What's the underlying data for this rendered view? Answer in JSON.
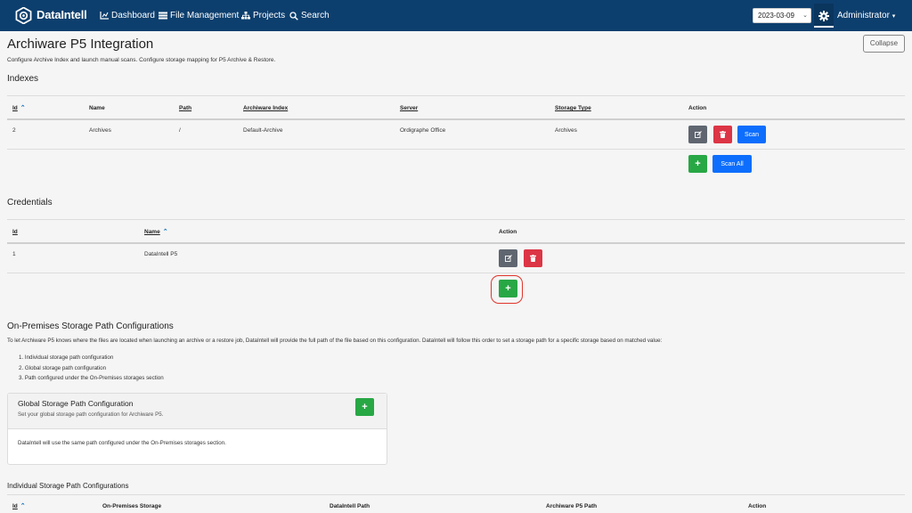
{
  "nav": {
    "brand": "DataIntell",
    "links": [
      {
        "label": "Dashboard",
        "icon": "chart-line-icon"
      },
      {
        "label": "File Management",
        "icon": "list-icon"
      },
      {
        "label": "Projects",
        "icon": "sitemap-icon"
      },
      {
        "label": "Search",
        "icon": "search-icon"
      }
    ],
    "date": "2023-03-09",
    "user": "Administrator"
  },
  "page": {
    "title": "Archiware P5 Integration",
    "subtitle": "Configure Archive Index and launch manual scans. Configure storage mapping for P5 Archive & Restore.",
    "collapse_label": "Collapse"
  },
  "indexes": {
    "heading": "Indexes",
    "columns": [
      "Id",
      "Name",
      "Path",
      "Archiware Index",
      "Server",
      "Storage Type",
      "Action"
    ],
    "rows": [
      {
        "id": "2",
        "name": "Archives",
        "path": "/",
        "index": "Default-Archive",
        "server": "Ordigraphe Office",
        "storage_type": "Archives"
      }
    ],
    "scan_label": "Scan",
    "scan_all_label": "Scan All",
    "add_symbol": "+"
  },
  "credentials": {
    "heading": "Credentials",
    "columns": [
      "Id",
      "Name",
      "Action"
    ],
    "rows": [
      {
        "id": "1",
        "name": "DataIntell P5"
      }
    ],
    "add_symbol": "+"
  },
  "onprem": {
    "heading": "On-Premises Storage Path Configurations",
    "description": "To let Archiware P5 knows where the files are located when launching an archive or a restore job, DataIntell will provide the full path of the file based on this configuration. DataIntell will follow this order to set a storage path for a specific storage based on matched value:",
    "order": [
      "1. Individual storage path configuration",
      "2. Global storage path configuration",
      "3. Path configured under the On-Premises storages section"
    ],
    "global_card": {
      "title": "Global Storage Path Configuration",
      "subtitle": "Set your global storage path configuration for Archiware P5.",
      "body": "DataIntell will use the same path configured under the On-Premises storages section.",
      "add_symbol": "+"
    },
    "individual": {
      "heading": "Individual Storage Path Configurations",
      "columns": [
        "Id",
        "On-Premises Storage",
        "DataIntell Path",
        "Archiware P5 Path",
        "Action"
      ]
    }
  },
  "colors": {
    "navbar": "#0d3f6e",
    "primary": "#0d6efd",
    "danger": "#dc3545",
    "success": "#28a745",
    "secondary": "#5f6670",
    "highlight_ring": "#e0352b"
  }
}
